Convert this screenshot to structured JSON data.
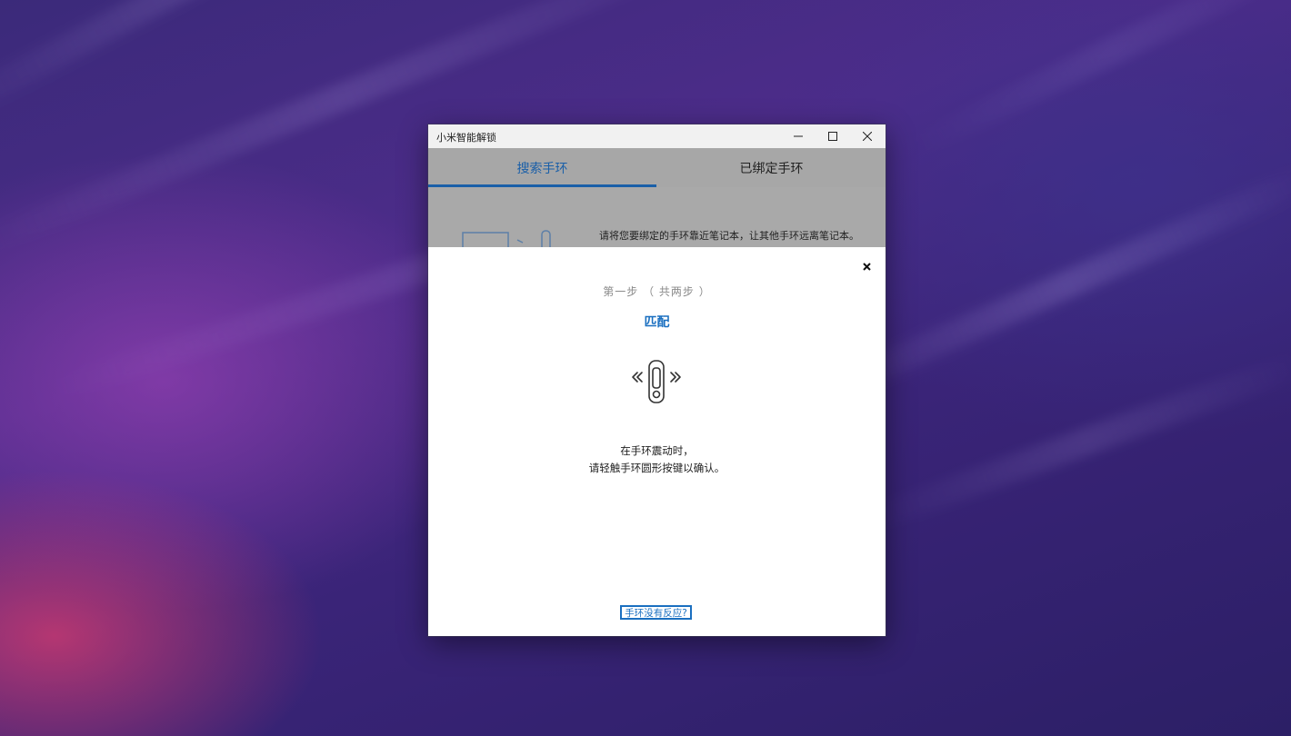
{
  "window": {
    "title": "小米智能解锁"
  },
  "tabs": [
    {
      "label": "搜索手环",
      "active": true
    },
    {
      "label": "已绑定手环",
      "active": false
    }
  ],
  "background_panel": {
    "hint": "请将您要绑定的手环靠近笔记本，让其他手环远离笔记本。"
  },
  "dialog": {
    "step": "第一步 （ 共两步 ）",
    "heading": "匹配",
    "instruction_line1": "在手环震动时，",
    "instruction_line2": "请轻触手环圆形按键以确认。",
    "no_response_link": "手环没有反应?"
  },
  "colors": {
    "accent": "#1a6fc0",
    "tab_bar": "#a7a7a7",
    "titlebar": "#f1f1f1"
  },
  "icons": [
    "minimize-icon",
    "maximize-icon",
    "close-icon",
    "dialog-close-icon",
    "vibrating-band-icon",
    "laptop-icon",
    "band-icon"
  ]
}
